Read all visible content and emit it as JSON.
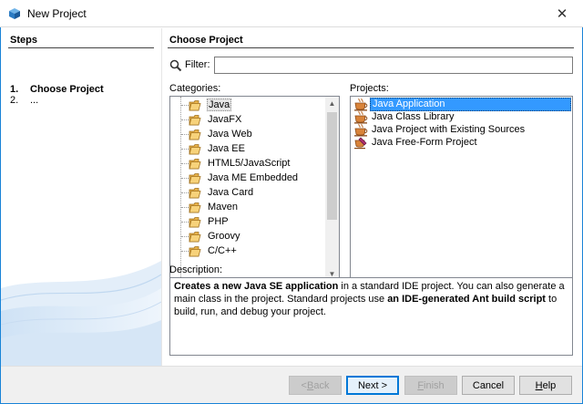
{
  "window": {
    "title": "New Project"
  },
  "steps": {
    "title": "Steps",
    "items": [
      {
        "num": "1.",
        "label": "Choose Project"
      },
      {
        "num": "2.",
        "label": "..."
      }
    ]
  },
  "main": {
    "title": "Choose Project",
    "filter": {
      "label": "Filter:",
      "value": ""
    },
    "categories": {
      "label": "Categories:",
      "items": [
        "Java",
        "JavaFX",
        "Java Web",
        "Java EE",
        "HTML5/JavaScript",
        "Java ME Embedded",
        "Java Card",
        "Maven",
        "PHP",
        "Groovy",
        "C/C++"
      ],
      "selected": "Java"
    },
    "projects": {
      "label": "Projects:",
      "items": [
        "Java Application",
        "Java Class Library",
        "Java Project with Existing Sources",
        "Java Free-Form Project"
      ],
      "selected": "Java Application"
    },
    "description": {
      "label": "Description:",
      "parts": [
        {
          "text": "Creates a new Java SE application",
          "bold": true
        },
        {
          "text": " in a standard IDE project. You can also generate a main class in the project. Standard projects use ",
          "bold": false
        },
        {
          "text": "an IDE-generated Ant build script",
          "bold": true
        },
        {
          "text": " to build, run, and debug your project.",
          "bold": false
        }
      ]
    }
  },
  "buttons": {
    "back": {
      "pre": "< ",
      "mnemonic": "B",
      "post": "ack",
      "enabled": false
    },
    "next": {
      "pre": "Next >",
      "mnemonic": "",
      "post": "",
      "enabled": true
    },
    "finish": {
      "pre": "",
      "mnemonic": "F",
      "post": "inish",
      "enabled": false
    },
    "cancel": {
      "pre": "Cancel",
      "mnemonic": "",
      "post": "",
      "enabled": true
    },
    "help": {
      "pre": "",
      "mnemonic": "H",
      "post": "elp",
      "enabled": true
    }
  },
  "colors": {
    "accent": "#1883d7",
    "selection": "#3399ff"
  }
}
